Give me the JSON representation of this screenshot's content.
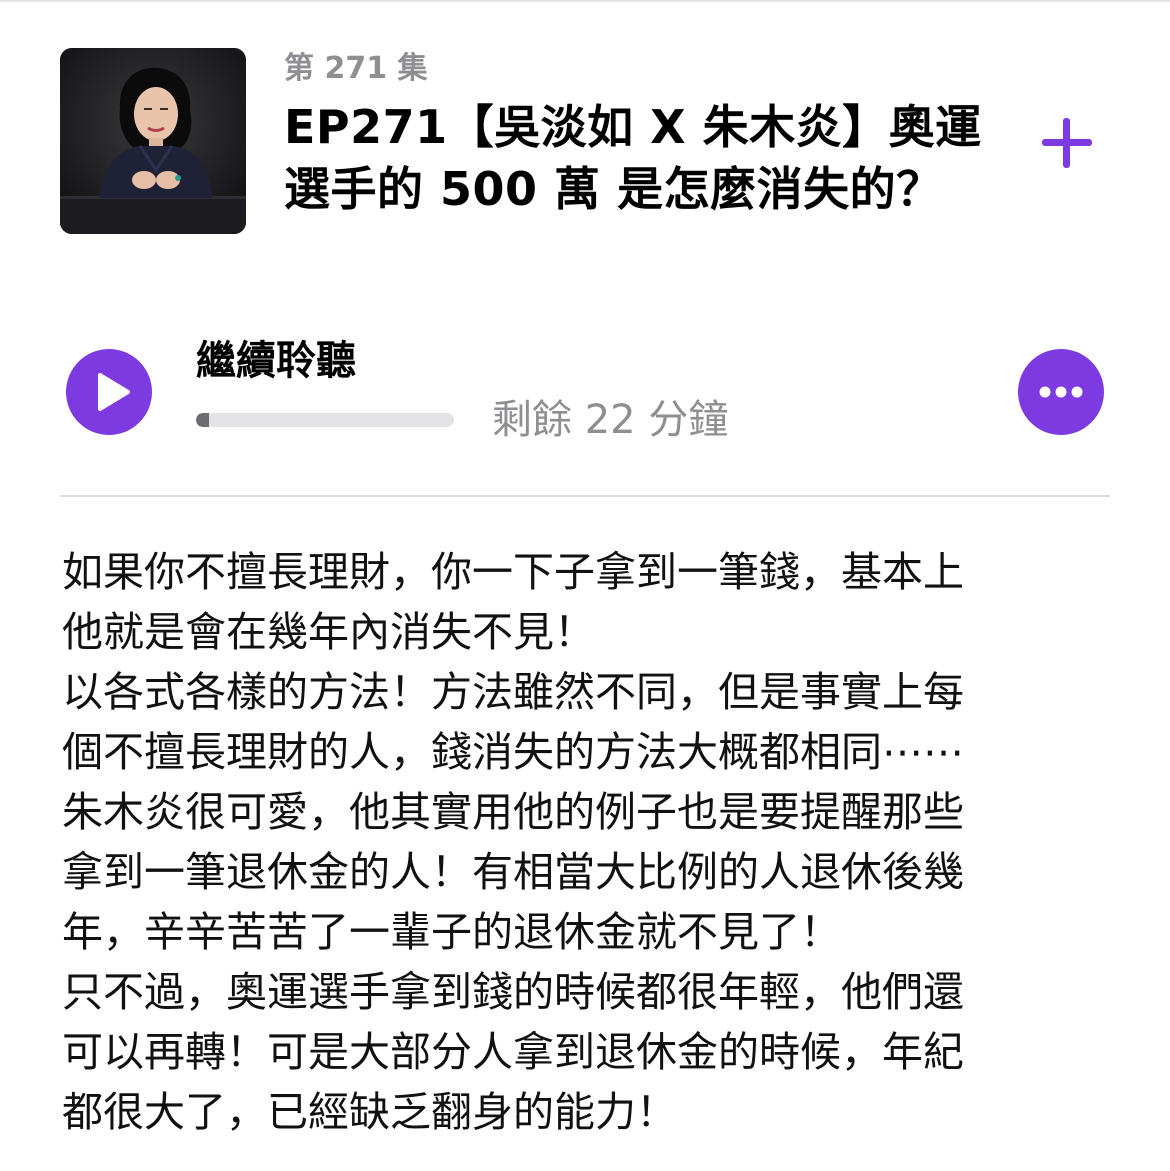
{
  "episode": {
    "number_label": "第 271 集",
    "title": "EP271【吳淡如 X 朱木炎】奧運選手的 500 萬 是怎麼消失的？"
  },
  "artwork": {
    "icon": "podcast-cover-portrait"
  },
  "actions": {
    "add_icon": "plus-icon",
    "play_icon": "play-icon",
    "more_icon": "ellipsis-icon"
  },
  "player": {
    "continue_label": "繼續聆聽",
    "time_remaining": "剩餘 22 分鐘",
    "progress_fraction": 0.05
  },
  "colors": {
    "accent": "#7d3ae0",
    "secondary_text": "#8e8e93",
    "progress_track": "#e3e3e6",
    "progress_fill": "#6b6b70"
  },
  "description": {
    "lines": [
      "如果你不擅長理財，你一下子拿到一筆錢，基本上",
      "他就是會在幾年內消失不見！",
      "以各式各樣的方法！方法雖然不同，但是事實上每",
      "個不擅長理財的人，錢消失的方法大概都相同⋯⋯",
      "朱木炎很可愛，他其實用他的例子也是要提醒那些",
      "拿到一筆退休金的人！有相當大比例的人退休後幾",
      "年，辛辛苦苦了一輩子的退休金就不見了！",
      "只不過，奧運選手拿到錢的時候都很年輕，他們還",
      "可以再轉！可是大部分人拿到退休金的時候，年紀",
      "都很大了，已經缺乏翻身的能力！"
    ]
  }
}
